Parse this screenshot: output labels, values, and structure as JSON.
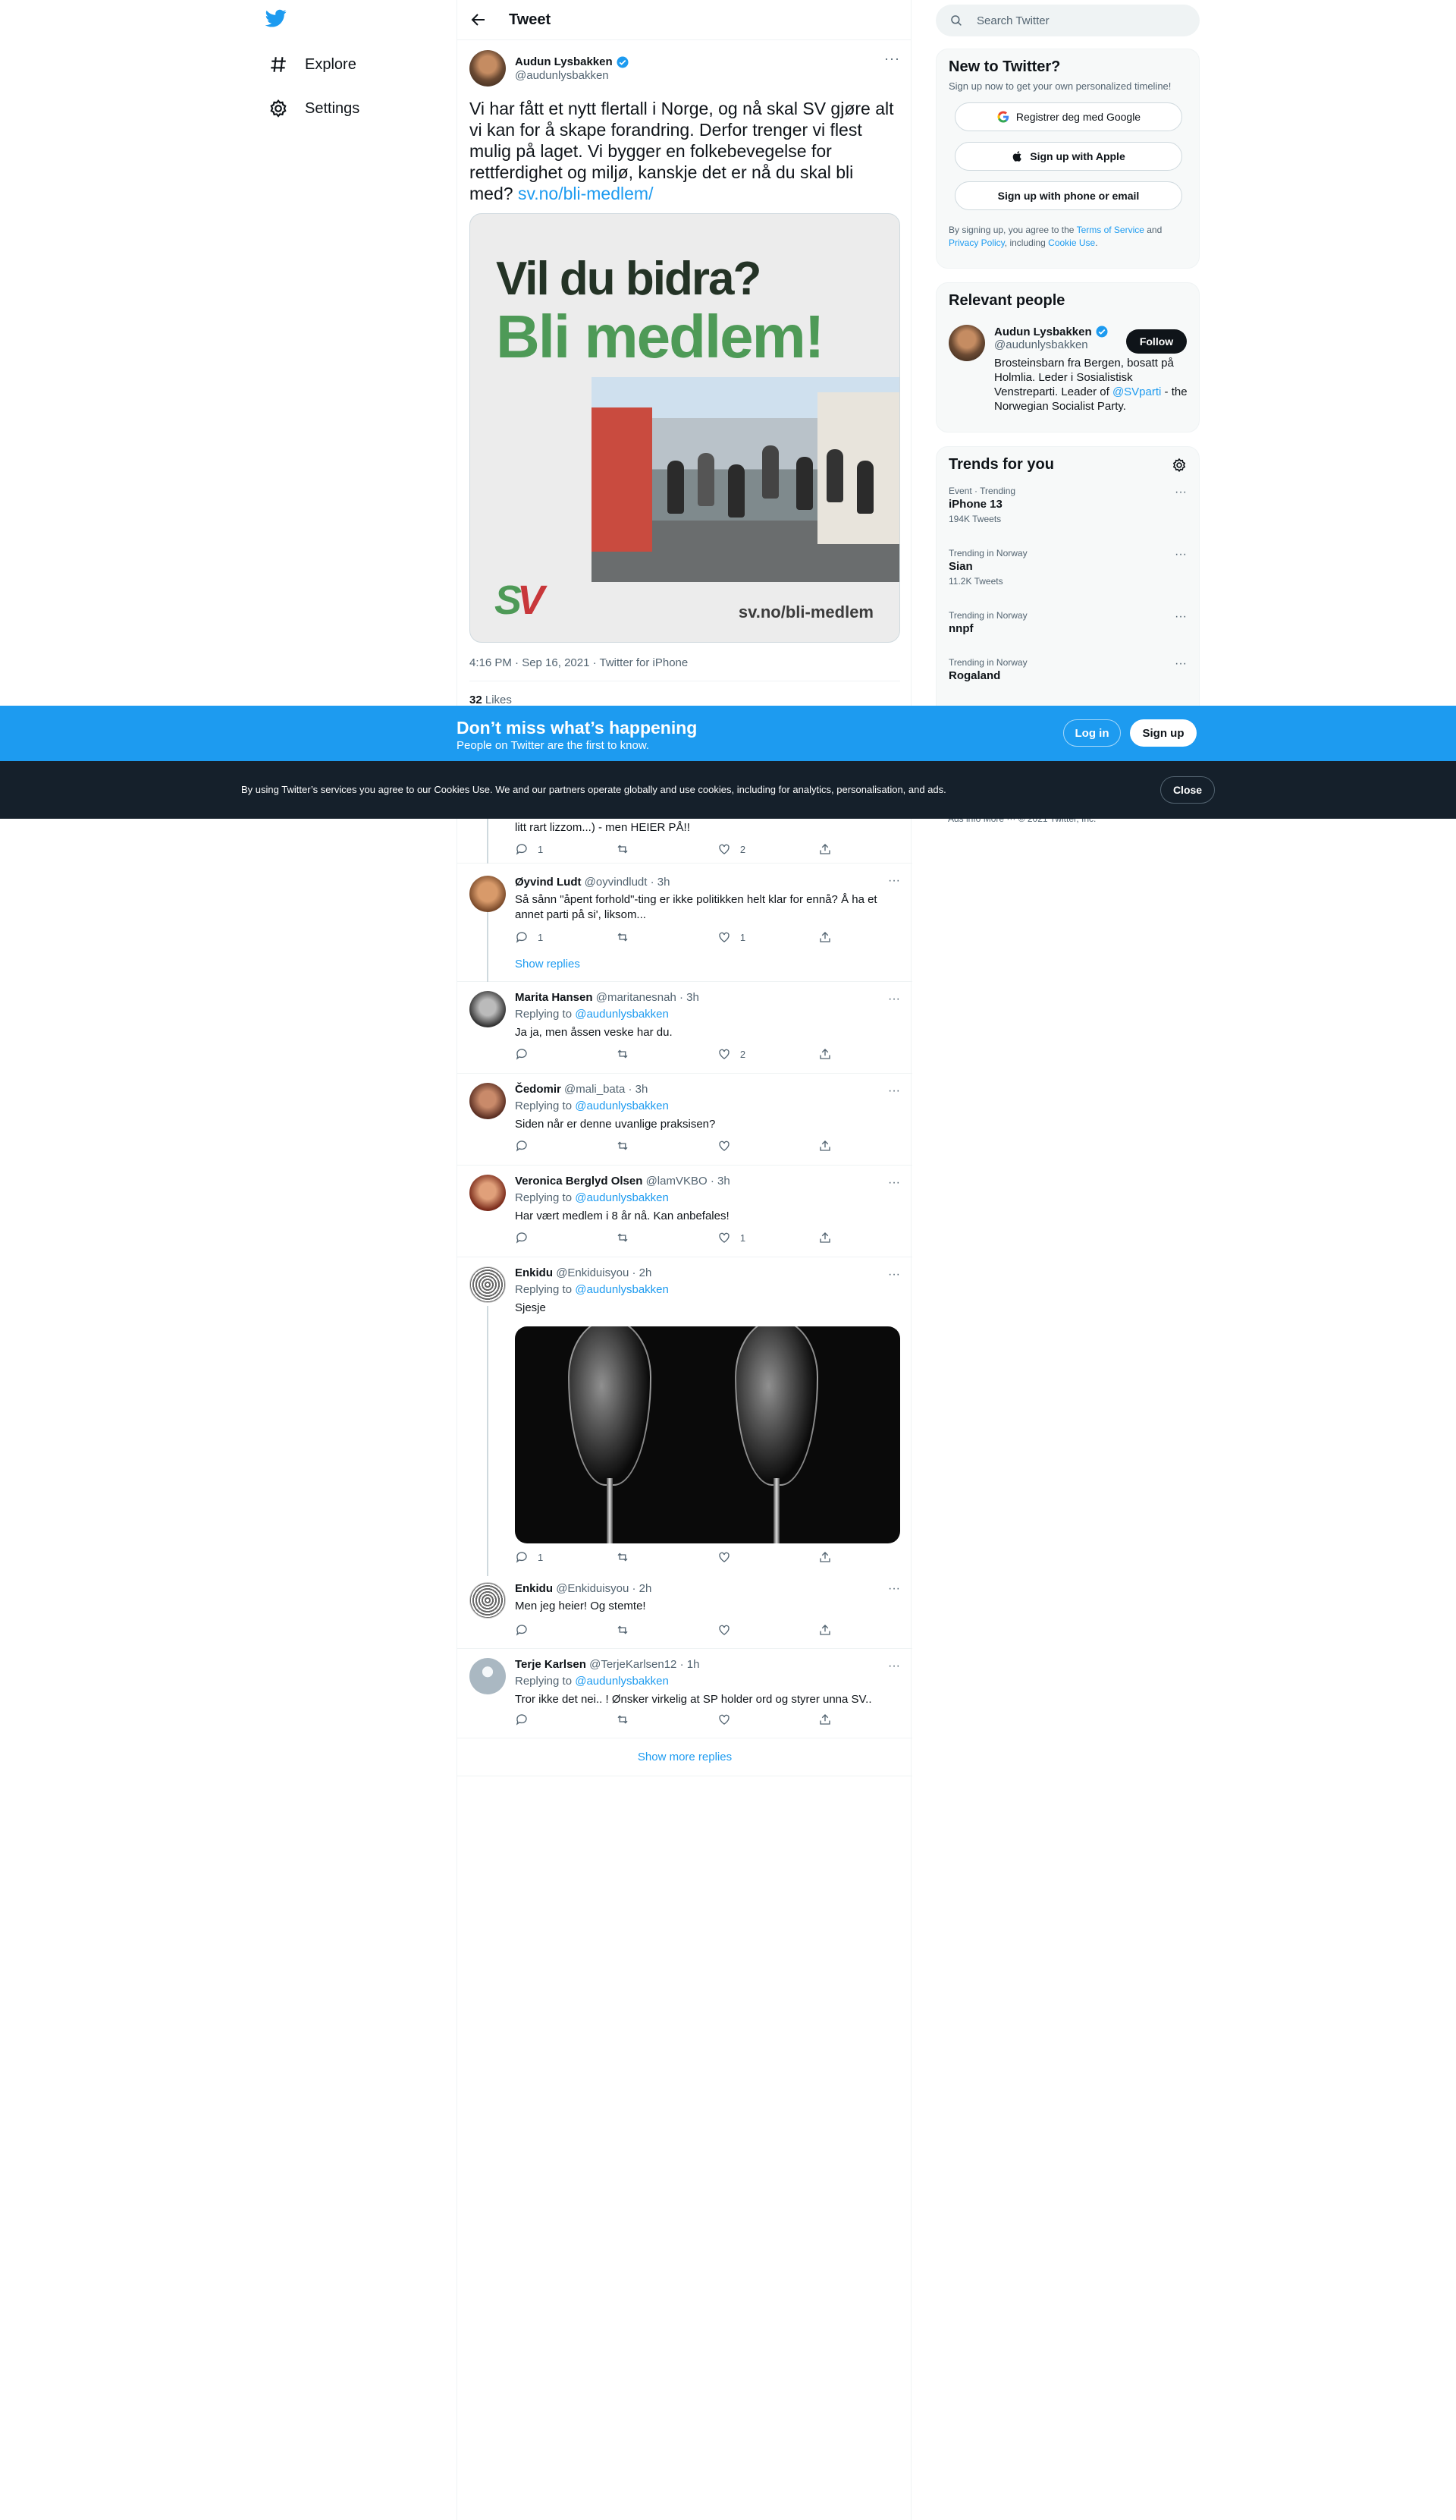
{
  "nav": {
    "explore_label": "Explore",
    "settings_label": "Settings"
  },
  "header": {
    "title": "Tweet"
  },
  "main_tweet": {
    "author_name": "Audun Lysbakken",
    "author_handle": "@audunlysbakken",
    "text": "Vi har fått et nytt flertall i Norge, og nå skal SV gjøre alt vi kan for å skape forandring. Derfor trenger vi flest mulig på laget. Vi bygger en folkebevegelse for rettferdighet og miljø, kanskje det er nå du skal bli med? ",
    "link": "sv.no/bli-medlem/",
    "card": {
      "line1": "Vil du bidra?",
      "line2": "Bli medlem!",
      "logo_s": "S",
      "logo_v": "V",
      "url": "sv.no/bli-medlem"
    },
    "meta": "4:16 PM · Sep 16, 2021 · Twitter for iPhone",
    "likes_count": "32",
    "likes_label": "Likes"
  },
  "replies": [
    {
      "text": "litt rart lizzom...) - men HEIER PÅ!!",
      "reply_count": "1",
      "retweet_count": "",
      "like_count": "2"
    },
    {
      "name": "Øyvind Ludt",
      "handle": "@oyvindludt",
      "time": "· 3h",
      "text": "Så sånn \"åpent forhold\"-ting er ikke politikken helt klar for ennå? Å ha et annet parti på si', liksom...",
      "reply_count": "1",
      "retweet_count": "",
      "like_count": "1",
      "show_replies": "Show replies"
    },
    {
      "name": "Marita Hansen",
      "handle": "@maritanesnah",
      "time": "· 3h",
      "replying_label": "Replying to",
      "replying_to": "@audunlysbakken",
      "text": "Ja ja, men åssen veske har du.",
      "reply_count": "",
      "retweet_count": "",
      "like_count": "2"
    },
    {
      "name": "Čedomir",
      "handle": "@mali_bata",
      "time": "· 3h",
      "replying_label": "Replying to",
      "replying_to": "@audunlysbakken",
      "text": "Siden når er denne uvanlige praksisen?",
      "reply_count": "",
      "retweet_count": "",
      "like_count": ""
    },
    {
      "name": "Veronica Berglyd Olsen",
      "handle": "@lamVKBO",
      "time": "· 3h",
      "replying_label": "Replying to",
      "replying_to": "@audunlysbakken",
      "text": "Har vært medlem i 8 år nå. Kan anbefales!",
      "reply_count": "",
      "retweet_count": "",
      "like_count": "1"
    },
    {
      "name": "Enkidu",
      "handle": "@Enkiduisyou",
      "time": "· 2h",
      "replying_label": "Replying to",
      "replying_to": "@audunlysbakken",
      "text": "Sjesje",
      "reply_count": "1",
      "retweet_count": "",
      "like_count": ""
    },
    {
      "name": "Enkidu",
      "handle": "@Enkiduisyou",
      "time": "· 2h",
      "text": "Men jeg heier! Og stemte!",
      "reply_count": "",
      "retweet_count": "",
      "like_count": ""
    },
    {
      "name": "Terje Karlsen",
      "handle": "@TerjeKarlsen12",
      "time": "· 1h",
      "replying_label": "Replying to",
      "replying_to": "@audunlysbakken",
      "text": "Tror ikke det nei.. ! Ønsker virkelig at SP holder ord og styrer unna SV..",
      "reply_count": "",
      "retweet_count": "",
      "like_count": ""
    }
  ],
  "show_more_replies": "Show more replies",
  "search": {
    "placeholder": "Search Twitter"
  },
  "new_to_twitter": {
    "title": "New to Twitter?",
    "subtitle": "Sign up now to get your own personalized timeline!",
    "google_label": "Registrer deg med Google",
    "apple_label": "Sign up with Apple",
    "email_label": "Sign up with phone or email",
    "terms_prefix": "By signing up, you agree to the ",
    "terms_link": "Terms of Service",
    "terms_and": " and ",
    "privacy_link": "Privacy Policy",
    "terms_including": ", including ",
    "cookie_link": "Cookie Use",
    "terms_end": "."
  },
  "relevant_people": {
    "title": "Relevant people",
    "name": "Audun Lysbakken",
    "handle": "@audunlysbakken",
    "follow_label": "Follow",
    "bio_1": "Brosteinsbarn fra Bergen, bosatt på Holmlia. Leder i Sosialistisk Venstreparti. Leader of ",
    "bio_link": "@SVparti",
    "bio_2": " - the Norwegian Socialist Party."
  },
  "trends": {
    "title": "Trends for you",
    "items": [
      {
        "context": "Event · Trending",
        "name": "iPhone 13",
        "count": "194K Tweets"
      },
      {
        "context": "Trending in Norway",
        "name": "Sian",
        "count": "11.2K Tweets"
      },
      {
        "context": "Trending in Norway",
        "name": "nnpf",
        "count": ""
      },
      {
        "context": "Trending in Norway",
        "name": "Rogaland",
        "count": ""
      }
    ]
  },
  "footer": {
    "text": "Ads info   More ···   © 2021 Twitter, Inc."
  },
  "banner": {
    "title": "Don’t miss what’s happening",
    "subtitle": "People on Twitter are the first to know.",
    "login_label": "Log in",
    "signup_label": "Sign up"
  },
  "cookie": {
    "text": "By using Twitter’s services you agree to our Cookies Use. We and our partners operate globally and use cookies, including for analytics, personalisation, and ads.",
    "close_label": "Close"
  },
  "colors": {
    "brand": "#1d9bf0",
    "sv_green": "#4e9a57",
    "sv_red": "#c8373a",
    "dark": "#15202b"
  }
}
